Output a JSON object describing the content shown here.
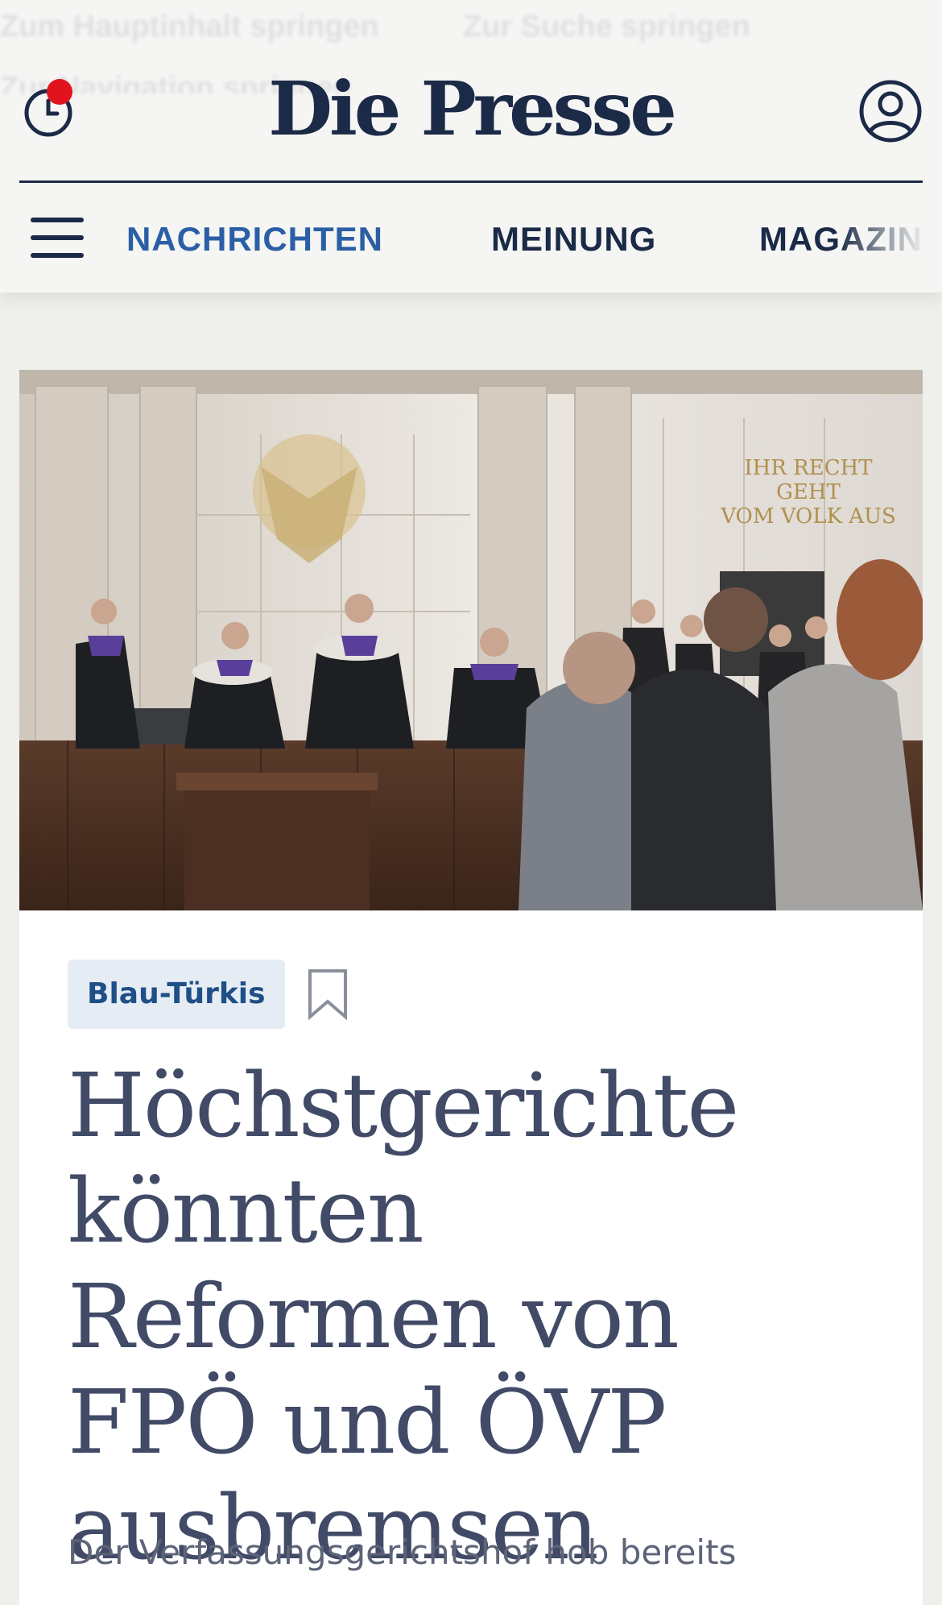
{
  "skip_links": [
    "Zum Hauptinhalt springen",
    "Zur Suche springen",
    "Zur Navigation springen"
  ],
  "brand": {
    "logo_text": "Die Presse",
    "primary_color": "#1b2a47",
    "accent_color": "#2b5fa5",
    "notification_color": "#e0131f"
  },
  "header": {
    "history_icon": "clock-icon",
    "history_has_notification": true,
    "account_icon": "user-circle-icon",
    "menu_icon": "hamburger-icon"
  },
  "nav": {
    "items": [
      {
        "label": "NACHRICHTEN",
        "active": true
      },
      {
        "label": "MEINUNG",
        "active": false
      },
      {
        "label": "MAGAZIN",
        "active": false
      }
    ]
  },
  "article": {
    "hero_image_description": "Richter im Verfassungsgerichtshof",
    "tag": "Blau-Türkis",
    "bookmark_icon": "bookmark-icon",
    "headline": "Höchstgerichte könnten Reformen von FPÖ und ÖVP ausbremsen",
    "teaser": "Der Verfassungsgerichtshof hob bereits"
  }
}
